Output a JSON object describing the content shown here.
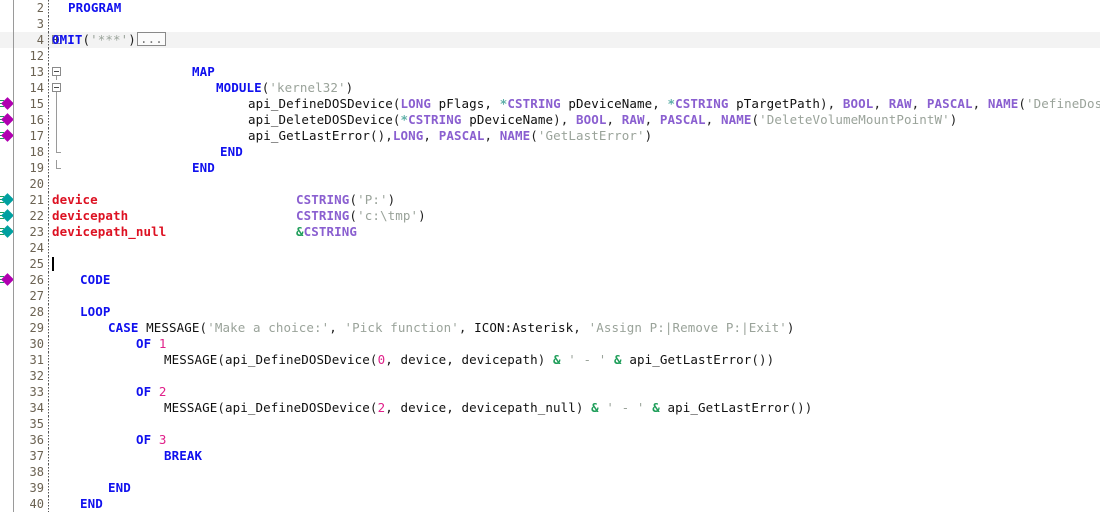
{
  "editor": {
    "name": "clarion-source-editor",
    "font_size_px": 12.5,
    "line_height_px": 16,
    "background": "#ffffff",
    "highlight_row_color": "#f3f3f3",
    "gutter_number_color": "#6b6252",
    "caret": {
      "line": 25,
      "visible": true
    }
  },
  "colors": {
    "keyword": "#1010ee",
    "type": "#8a5fd0",
    "string": "#9aa39a",
    "label": "#dd1122",
    "number": "#e0218a",
    "ampersand": "#1f9e5a",
    "bookmark_magenta": "#b000b0",
    "bookmark_teal": "#00a0a0",
    "fold_line": "#9a9a9a"
  },
  "lines": [
    {
      "number": "2",
      "marker": "none",
      "fold": "none",
      "highlight": false,
      "indent": 16,
      "tokens": [
        {
          "t": "PROGRAM",
          "c": "kw"
        }
      ]
    },
    {
      "number": "3",
      "marker": "none",
      "fold": "none",
      "highlight": false,
      "indent": 0,
      "tokens": []
    },
    {
      "number": "4",
      "marker": "none",
      "fold": "plus",
      "highlight": true,
      "indent": 0,
      "tokens": [
        {
          "t": "OMIT",
          "c": "kw"
        },
        {
          "t": "(",
          "c": "punct"
        },
        {
          "t": "'***'",
          "c": "str"
        },
        {
          "t": ")",
          "c": "punct"
        },
        {
          "t": "...",
          "c": "foldchip"
        }
      ]
    },
    {
      "number": "12",
      "marker": "none",
      "fold": "none",
      "highlight": false,
      "indent": 0,
      "tokens": []
    },
    {
      "number": "13",
      "marker": "none",
      "fold": "minus",
      "highlight": false,
      "indent": 140,
      "tokens": [
        {
          "t": "MAP",
          "c": "kw"
        }
      ]
    },
    {
      "number": "14",
      "marker": "none",
      "fold": "minus2",
      "highlight": false,
      "indent": 164,
      "tokens": [
        {
          "t": "MODULE",
          "c": "kw"
        },
        {
          "t": "(",
          "c": "punct"
        },
        {
          "t": "'kernel32'",
          "c": "str"
        },
        {
          "t": ")",
          "c": "punct"
        }
      ]
    },
    {
      "number": "15",
      "marker": "magenta",
      "fold": "stem",
      "highlight": false,
      "indent": 196,
      "tokens": [
        {
          "t": "api_DefineDOSDevice",
          "c": "plain"
        },
        {
          "t": "(",
          "c": "punct"
        },
        {
          "t": "LONG",
          "c": "typ"
        },
        {
          "t": " pFlags, ",
          "c": "plain"
        },
        {
          "t": "*",
          "c": "star"
        },
        {
          "t": "CSTRING",
          "c": "typ"
        },
        {
          "t": " pDeviceName, ",
          "c": "plain"
        },
        {
          "t": "*",
          "c": "star"
        },
        {
          "t": "CSTRING",
          "c": "typ"
        },
        {
          "t": " pTargetPath",
          "c": "plain"
        },
        {
          "t": "), ",
          "c": "punct"
        },
        {
          "t": "BOOL",
          "c": "typ"
        },
        {
          "t": ", ",
          "c": "punct"
        },
        {
          "t": "RAW",
          "c": "typ"
        },
        {
          "t": ", ",
          "c": "punct"
        },
        {
          "t": "PASCAL",
          "c": "typ"
        },
        {
          "t": ", ",
          "c": "punct"
        },
        {
          "t": "NAME",
          "c": "typ"
        },
        {
          "t": "(",
          "c": "punct"
        },
        {
          "t": "'DefineDosDeviceA'",
          "c": "str"
        },
        {
          "t": ")",
          "c": "punct"
        }
      ]
    },
    {
      "number": "16",
      "marker": "magenta",
      "fold": "stem",
      "highlight": false,
      "indent": 196,
      "tokens": [
        {
          "t": "api_DeleteDOSDevice",
          "c": "plain"
        },
        {
          "t": "(",
          "c": "punct"
        },
        {
          "t": "*",
          "c": "star"
        },
        {
          "t": "CSTRING",
          "c": "typ"
        },
        {
          "t": " pDeviceName",
          "c": "plain"
        },
        {
          "t": "), ",
          "c": "punct"
        },
        {
          "t": "BOOL",
          "c": "typ"
        },
        {
          "t": ", ",
          "c": "punct"
        },
        {
          "t": "RAW",
          "c": "typ"
        },
        {
          "t": ", ",
          "c": "punct"
        },
        {
          "t": "PASCAL",
          "c": "typ"
        },
        {
          "t": ", ",
          "c": "punct"
        },
        {
          "t": "NAME",
          "c": "typ"
        },
        {
          "t": "(",
          "c": "punct"
        },
        {
          "t": "'DeleteVolumeMountPointW'",
          "c": "str"
        },
        {
          "t": ")",
          "c": "punct"
        }
      ]
    },
    {
      "number": "17",
      "marker": "magenta",
      "fold": "stem",
      "highlight": false,
      "indent": 196,
      "tokens": [
        {
          "t": "api_GetLastError",
          "c": "plain"
        },
        {
          "t": "(),",
          "c": "punct"
        },
        {
          "t": "LONG",
          "c": "typ"
        },
        {
          "t": ", ",
          "c": "punct"
        },
        {
          "t": "PASCAL",
          "c": "typ"
        },
        {
          "t": ", ",
          "c": "punct"
        },
        {
          "t": "NAME",
          "c": "typ"
        },
        {
          "t": "(",
          "c": "punct"
        },
        {
          "t": "'GetLastError'",
          "c": "str"
        },
        {
          "t": ")",
          "c": "punct"
        }
      ]
    },
    {
      "number": "18",
      "marker": "none",
      "fold": "end-inner",
      "highlight": false,
      "indent": 168,
      "tokens": [
        {
          "t": "END",
          "c": "kw"
        }
      ]
    },
    {
      "number": "19",
      "marker": "none",
      "fold": "end-outer",
      "highlight": false,
      "indent": 140,
      "tokens": [
        {
          "t": "END",
          "c": "kw"
        }
      ]
    },
    {
      "number": "20",
      "marker": "none",
      "fold": "none",
      "highlight": false,
      "indent": 0,
      "tokens": []
    },
    {
      "number": "21",
      "marker": "teal",
      "fold": "none",
      "highlight": false,
      "indent": 0,
      "tokens": [
        {
          "t": "device",
          "c": "lbl"
        },
        {
          "t": "                          ",
          "c": "plain"
        },
        {
          "t": "CSTRING",
          "c": "typ"
        },
        {
          "t": "(",
          "c": "punct"
        },
        {
          "t": "'P:'",
          "c": "str"
        },
        {
          "t": ")",
          "c": "punct"
        }
      ]
    },
    {
      "number": "22",
      "marker": "teal",
      "fold": "none",
      "highlight": false,
      "indent": 0,
      "tokens": [
        {
          "t": "devicepath",
          "c": "lbl"
        },
        {
          "t": "                      ",
          "c": "plain"
        },
        {
          "t": "CSTRING",
          "c": "typ"
        },
        {
          "t": "(",
          "c": "punct"
        },
        {
          "t": "'c:\\tmp'",
          "c": "str"
        },
        {
          "t": ")",
          "c": "punct"
        }
      ]
    },
    {
      "number": "23",
      "marker": "teal",
      "fold": "none",
      "highlight": false,
      "indent": 0,
      "tokens": [
        {
          "t": "devicepath_null",
          "c": "lbl"
        },
        {
          "t": "                 ",
          "c": "plain"
        },
        {
          "t": "&",
          "c": "amp"
        },
        {
          "t": "CSTRING",
          "c": "typ"
        }
      ]
    },
    {
      "number": "24",
      "marker": "none",
      "fold": "none",
      "highlight": false,
      "indent": 0,
      "tokens": []
    },
    {
      "number": "25",
      "marker": "none",
      "fold": "none",
      "highlight": false,
      "indent": 0,
      "tokens": []
    },
    {
      "number": "26",
      "marker": "magenta",
      "fold": "none",
      "highlight": false,
      "indent": 28,
      "tokens": [
        {
          "t": "CODE",
          "c": "kw"
        }
      ]
    },
    {
      "number": "27",
      "marker": "none",
      "fold": "none",
      "highlight": false,
      "indent": 0,
      "tokens": []
    },
    {
      "number": "28",
      "marker": "none",
      "fold": "none",
      "highlight": false,
      "indent": 28,
      "tokens": [
        {
          "t": "LOOP",
          "c": "kw"
        }
      ]
    },
    {
      "number": "29",
      "marker": "none",
      "fold": "none",
      "highlight": false,
      "indent": 56,
      "tokens": [
        {
          "t": "CASE",
          "c": "kw"
        },
        {
          "t": " ",
          "c": "plain"
        },
        {
          "t": "MESSAGE",
          "c": "plain"
        },
        {
          "t": "(",
          "c": "punct"
        },
        {
          "t": "'Make a choice:'",
          "c": "str"
        },
        {
          "t": ", ",
          "c": "punct"
        },
        {
          "t": "'Pick function'",
          "c": "str"
        },
        {
          "t": ", ",
          "c": "punct"
        },
        {
          "t": "ICON",
          "c": "plain"
        },
        {
          "t": ":",
          "c": "punct"
        },
        {
          "t": "Asterisk",
          "c": "plain"
        },
        {
          "t": ", ",
          "c": "punct"
        },
        {
          "t": "'Assign P:|Remove P:|Exit'",
          "c": "str"
        },
        {
          "t": ")",
          "c": "punct"
        }
      ]
    },
    {
      "number": "30",
      "marker": "none",
      "fold": "none",
      "highlight": false,
      "indent": 84,
      "tokens": [
        {
          "t": "OF",
          "c": "kw"
        },
        {
          "t": " ",
          "c": "plain"
        },
        {
          "t": "1",
          "c": "num"
        }
      ]
    },
    {
      "number": "31",
      "marker": "none",
      "fold": "none",
      "highlight": false,
      "indent": 112,
      "tokens": [
        {
          "t": "MESSAGE",
          "c": "plain"
        },
        {
          "t": "(",
          "c": "punct"
        },
        {
          "t": "api_DefineDOSDevice",
          "c": "plain"
        },
        {
          "t": "(",
          "c": "punct"
        },
        {
          "t": "0",
          "c": "num"
        },
        {
          "t": ", device, devicepath",
          "c": "plain"
        },
        {
          "t": ") ",
          "c": "punct"
        },
        {
          "t": "&",
          "c": "amp"
        },
        {
          "t": " ",
          "c": "plain"
        },
        {
          "t": "' - '",
          "c": "str"
        },
        {
          "t": " ",
          "c": "plain"
        },
        {
          "t": "&",
          "c": "amp"
        },
        {
          "t": " api_GetLastError",
          "c": "plain"
        },
        {
          "t": "())",
          "c": "punct"
        }
      ]
    },
    {
      "number": "32",
      "marker": "none",
      "fold": "none",
      "highlight": false,
      "indent": 0,
      "tokens": []
    },
    {
      "number": "33",
      "marker": "none",
      "fold": "none",
      "highlight": false,
      "indent": 84,
      "tokens": [
        {
          "t": "OF",
          "c": "kw"
        },
        {
          "t": " ",
          "c": "plain"
        },
        {
          "t": "2",
          "c": "num"
        }
      ]
    },
    {
      "number": "34",
      "marker": "none",
      "fold": "none",
      "highlight": false,
      "indent": 112,
      "tokens": [
        {
          "t": "MESSAGE",
          "c": "plain"
        },
        {
          "t": "(",
          "c": "punct"
        },
        {
          "t": "api_DefineDOSDevice",
          "c": "plain"
        },
        {
          "t": "(",
          "c": "punct"
        },
        {
          "t": "2",
          "c": "num"
        },
        {
          "t": ", device, devicepath_null",
          "c": "plain"
        },
        {
          "t": ") ",
          "c": "punct"
        },
        {
          "t": "&",
          "c": "amp"
        },
        {
          "t": " ",
          "c": "plain"
        },
        {
          "t": "' - '",
          "c": "str"
        },
        {
          "t": " ",
          "c": "plain"
        },
        {
          "t": "&",
          "c": "amp"
        },
        {
          "t": " api_GetLastError",
          "c": "plain"
        },
        {
          "t": "())",
          "c": "punct"
        }
      ]
    },
    {
      "number": "35",
      "marker": "none",
      "fold": "none",
      "highlight": false,
      "indent": 0,
      "tokens": []
    },
    {
      "number": "36",
      "marker": "none",
      "fold": "none",
      "highlight": false,
      "indent": 84,
      "tokens": [
        {
          "t": "OF",
          "c": "kw"
        },
        {
          "t": " ",
          "c": "plain"
        },
        {
          "t": "3",
          "c": "num"
        }
      ]
    },
    {
      "number": "37",
      "marker": "none",
      "fold": "none",
      "highlight": false,
      "indent": 112,
      "tokens": [
        {
          "t": "BREAK",
          "c": "kw"
        }
      ]
    },
    {
      "number": "38",
      "marker": "none",
      "fold": "none",
      "highlight": false,
      "indent": 0,
      "tokens": []
    },
    {
      "number": "39",
      "marker": "none",
      "fold": "none",
      "highlight": false,
      "indent": 56,
      "tokens": [
        {
          "t": "END",
          "c": "kw"
        }
      ]
    },
    {
      "number": "40",
      "marker": "none",
      "fold": "none",
      "highlight": false,
      "indent": 28,
      "tokens": [
        {
          "t": "END",
          "c": "kw"
        }
      ]
    }
  ]
}
